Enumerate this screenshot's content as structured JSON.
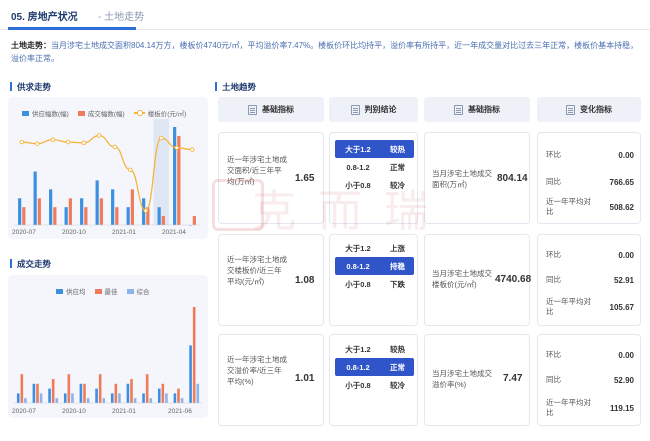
{
  "header": {
    "number_title": "05. 房地产状况",
    "sub_title": "- 土地走势"
  },
  "summary": {
    "label": "土地走势：",
    "text": "当月涉宅土地成交面积804.14万方，楼板价4740元/㎡，平均溢价率7.47%。楼板价环比均持平，溢价率有所持平，近一年成交量对比过去三年正常，楼板价基本持稳，溢价率正常。"
  },
  "supply_chart": {
    "section_title": "供求走势",
    "legend": [
      "供应幅数(幅)",
      "成交幅数(幅)",
      "楼板价(元/㎡)"
    ],
    "colors": {
      "supply": "#3d8fe0",
      "deal": "#ef7b5a",
      "price": "#f5b43b",
      "highlight": "#dfe7f5"
    },
    "x_ticks": [
      "2020-07",
      "2020-10",
      "2021-01",
      "2021-04"
    ]
  },
  "deal_chart": {
    "section_title": "成交走势",
    "legend": [
      "供应均",
      "最佳",
      "综合"
    ],
    "colors": {
      "a": "#3d8fe0",
      "b": "#ef7b5a",
      "c": "#8ab4ea"
    },
    "x_ticks": [
      "2020-07",
      "2020-10",
      "2021-01",
      "2021-06"
    ]
  },
  "chart_data": [
    {
      "type": "bar",
      "title": "供求走势",
      "categories": [
        "2020-07",
        "2020-08",
        "2020-09",
        "2020-10",
        "2020-11",
        "2020-12",
        "2021-01",
        "2021-02",
        "2021-03",
        "2021-04",
        "2021-05",
        "2021-06"
      ],
      "series": [
        {
          "name": "供应幅数(幅)",
          "values": [
            3,
            6,
            4,
            2,
            3,
            5,
            4,
            2,
            3,
            2,
            11,
            0
          ]
        },
        {
          "name": "成交幅数(幅)",
          "values": [
            2,
            3,
            2,
            3,
            2,
            3,
            2,
            4,
            2,
            1,
            10,
            1
          ]
        },
        {
          "name": "楼板价(元/㎡)",
          "values": [
            5200,
            5100,
            5350,
            5200,
            5150,
            5600,
            4900,
            3500,
            1000,
            5450,
            4850,
            4740
          ]
        }
      ]
    },
    {
      "type": "bar",
      "title": "成交走势",
      "categories": [
        "2020-07",
        "2020-08",
        "2020-09",
        "2020-10",
        "2020-11",
        "2020-12",
        "2021-01",
        "2021-02",
        "2021-03",
        "2021-04",
        "2021-05",
        "2021-06"
      ],
      "series": [
        {
          "name": "供应均",
          "values": [
            1,
            2,
            1.5,
            1,
            2,
            1.5,
            1,
            2,
            1,
            1.5,
            1,
            6
          ]
        },
        {
          "name": "最佳",
          "values": [
            3,
            2,
            2.5,
            3,
            2,
            3,
            2,
            2.5,
            3,
            2,
            1.5,
            10
          ]
        },
        {
          "name": "综合",
          "values": [
            0.5,
            1,
            0.5,
            1,
            0.5,
            0.5,
            1,
            0.5,
            0.5,
            1,
            0.5,
            2
          ]
        }
      ]
    }
  ],
  "land_trend": {
    "section_title": "土地趋势",
    "headers": [
      "基础指标",
      "判别结论",
      "基础指标",
      "变化指标"
    ],
    "rows": [
      {
        "index_label": "近一年涉宅土地成交面积/近三年平均(万㎡)",
        "index_value": "1.65",
        "judge": [
          {
            "cond": "大于1.2",
            "result": "较热",
            "active": true
          },
          {
            "cond": "0.8-1.2",
            "result": "正常",
            "active": false
          },
          {
            "cond": "小于0.8",
            "result": "较冷",
            "active": false
          }
        ],
        "base_label": "当月涉宅土地成交面积(万㎡)",
        "base_value": "804.14",
        "changes": [
          {
            "label": "环比",
            "value": "0.00"
          },
          {
            "label": "同比",
            "value": "766.65"
          },
          {
            "label": "近一年平均对比",
            "value": "508.62"
          }
        ]
      },
      {
        "index_label": "近一年涉宅土地成交楼板价/近三年平均(元/㎡)",
        "index_value": "1.08",
        "judge": [
          {
            "cond": "大于1.2",
            "result": "上涨",
            "active": false
          },
          {
            "cond": "0.8-1.2",
            "result": "持稳",
            "active": true
          },
          {
            "cond": "小于0.8",
            "result": "下跌",
            "active": false
          }
        ],
        "base_label": "当月涉宅土地成交楼板价(元/㎡)",
        "base_value": "4740.68",
        "changes": [
          {
            "label": "环比",
            "value": "0.00"
          },
          {
            "label": "同比",
            "value": "52.91"
          },
          {
            "label": "近一年平均对比",
            "value": "105.67"
          }
        ]
      },
      {
        "index_label": "近一年涉宅土地成交溢价率/近三年平均(%)",
        "index_value": "1.01",
        "judge": [
          {
            "cond": "大于1.2",
            "result": "较热",
            "active": false
          },
          {
            "cond": "0.8-1.2",
            "result": "正常",
            "active": true
          },
          {
            "cond": "小于0.8",
            "result": "较冷",
            "active": false
          }
        ],
        "base_label": "当月涉宅土地成交溢价率(%)",
        "base_value": "7.47",
        "changes": [
          {
            "label": "环比",
            "value": "0.00"
          },
          {
            "label": "同比",
            "value": "52.90"
          },
          {
            "label": "近一年平均对比",
            "value": "119.15"
          }
        ]
      }
    ]
  },
  "watermark": {
    "text": "克而瑞"
  }
}
